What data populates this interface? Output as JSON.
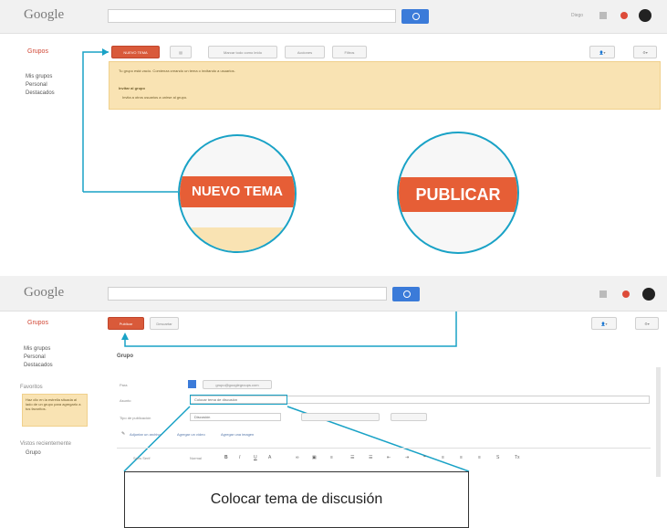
{
  "top_screen": {
    "logo": "Google",
    "app_title": "Grupos",
    "header_right_text": "Diego",
    "sidebar_items": [
      "Mis grupos",
      "Personal",
      "Destacados"
    ],
    "toolbar": {
      "new_topic": "NUEVO TEMA",
      "group_settings": "Marcar todo como leído",
      "actions": "Acciones",
      "filter": "Filtros"
    },
    "notice": {
      "line1": "Tu grupo está vacío. Comienza creando un tema o invitando a usuarios.",
      "line2": "Invitar al grupo",
      "line3": "Invita a otros usuarios a unirse al grupo."
    }
  },
  "zoom_left": {
    "label": "NUEVO TEMA"
  },
  "zoom_right": {
    "label": "PUBLICAR"
  },
  "bottom_screen": {
    "logo": "Google",
    "app_title": "Grupos",
    "publish_button": "Publicar",
    "cancel_button": "Descartar",
    "sidebar_items": [
      "Mis grupos",
      "Personal",
      "Destacados"
    ],
    "sidebar_favorites": "Favoritos",
    "sidebar_tip": "Haz clic en la estrella situada al lado de un grupo para agregarlo a tus favoritos.",
    "sidebar_recent": "Vistos recientemente",
    "sidebar_recent_item": "Grupo",
    "compose_title": "Grupo",
    "labels": {
      "to": "Para",
      "subject": "Asunto",
      "type": "Tipo de publicación"
    },
    "to_value": "grupo@googlegroups.com",
    "subject_value": "Colocar tema de discusión",
    "type_value": "Discusión",
    "attach": "Adjuntar un archivo",
    "attach_more": "Agregar un vídeo",
    "attach_more2": "Agregar una imagen",
    "font_select": "Sans Serif",
    "size_select": "Normal"
  },
  "callout_text": "Colocar tema de discusión",
  "colors": {
    "accent": "#19a2c6",
    "brand_red": "#d95a3a",
    "search_blue": "#3b7bd9",
    "notice_bg": "#f9e3b3"
  }
}
